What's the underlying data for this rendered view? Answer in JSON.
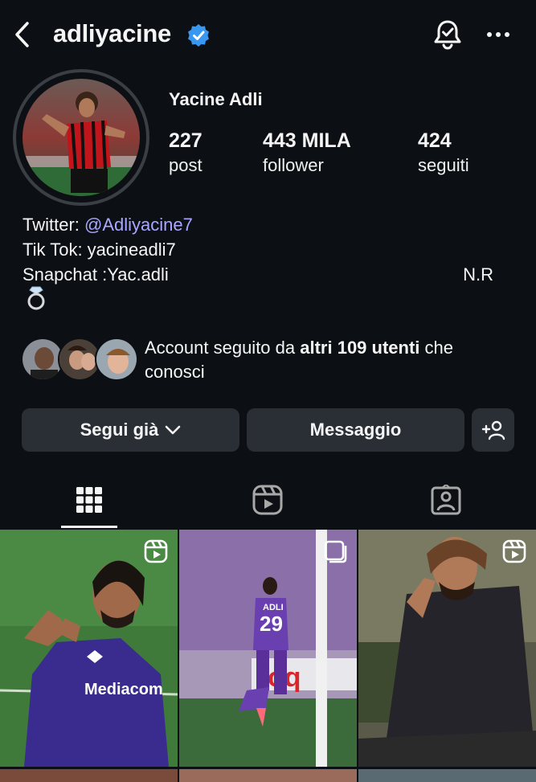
{
  "header": {
    "username": "adliyacine",
    "verified": true,
    "verified_color": "#3897f0"
  },
  "profile": {
    "full_name": "Yacine Adli",
    "stats": [
      {
        "value": "227",
        "label": "post"
      },
      {
        "value": "443 MILA",
        "label": "follower"
      },
      {
        "value": "424",
        "label": "seguiti"
      }
    ]
  },
  "bio": {
    "twitter_prefix": "Twitter: ",
    "twitter_handle": "@Adliyacine7",
    "tiktok": "Tik Tok: yacineadli7",
    "snapchat": "Snapchat :Yac.adli",
    "initials": "N.R",
    "emoji": "ring-icon"
  },
  "mutuals": {
    "prefix": "Account seguito da ",
    "bold": "altri 109 utenti",
    "suffix": " che conosci"
  },
  "actions": {
    "follow_label": "Segui già",
    "message_label": "Messaggio",
    "add_user_icon": "add-person-icon"
  },
  "tabs": [
    {
      "name": "grid-icon",
      "active": true
    },
    {
      "name": "reels-icon",
      "active": false
    },
    {
      "name": "tagged-icon",
      "active": false
    }
  ],
  "posts": [
    {
      "type": "reel",
      "badge": "reels-icon",
      "jersey_text": "Mediacom",
      "jersey_color": "#3a2c8f"
    },
    {
      "type": "multi",
      "badge": "carousel-icon",
      "player_name": "ADLI",
      "player_number": "29",
      "jersey_color": "#6a3fb0"
    },
    {
      "type": "reel",
      "badge": "reels-icon"
    }
  ],
  "colors": {
    "background": "#0c1014",
    "button": "#2a2f36",
    "link": "#a9a7ff"
  }
}
